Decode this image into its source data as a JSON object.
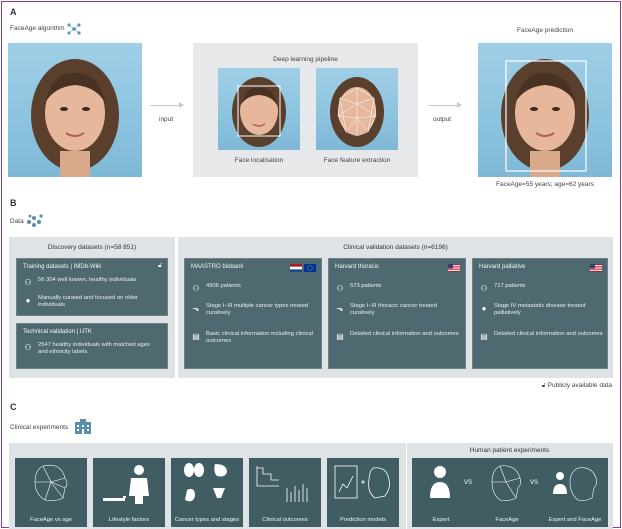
{
  "section_a": {
    "letter": "A",
    "algorithm_label": "FaceAge algorithm",
    "pipeline_title": "Deep learning pipeline",
    "input_label": "input",
    "output_label": "output",
    "step1_caption": "Face localisation",
    "step2_caption": "Face feature extraction",
    "prediction_title": "FaceAge prediction",
    "prediction_result": "FaceAge=55 years; age=62 years"
  },
  "section_b": {
    "letter": "B",
    "data_label": "Data",
    "discovery_title": "Discovery datasets (n=58 851)",
    "clinical_title": "Clinical validation datasets (n=6196)",
    "training": {
      "title": "Training datasets | IMDb-Wiki",
      "line1": "56 304 well known, healthy individuals",
      "line2": "Manually curated and focused on older individuals"
    },
    "technical": {
      "title": "Technical validation | UTK",
      "line1": "2547 healthy individuals with matched ages and ethnicity labels"
    },
    "maastro": {
      "title": "MAASTRO biobank",
      "patients": "4906 patients",
      "line2": "Stage I–III multiple cancer types treated curatively",
      "line3": "Basic clinical information including clinical outcomes"
    },
    "harvard_thoracic": {
      "title": "Harvard thoracic",
      "patients": "573 patients",
      "line2": "Stage I–III thoracic cancer treated curatively",
      "line3": "Detailed clinical information and outcomes"
    },
    "harvard_palliative": {
      "title": "Harvard palliative",
      "patients": "717 patients",
      "line2": "Stage IV metastatic disease treated palliatively",
      "line3": "Detailed clinical information and outcomes"
    },
    "public_note": "Publicly available data"
  },
  "section_c": {
    "letter": "C",
    "experiments_label": "Clinical experiments",
    "human_title": "Human patient experiments",
    "tiles": [
      "FaceAge vs age",
      "Lifestyle factors",
      "Cancer types and stages",
      "Clinical outcomes",
      "Prediction models"
    ],
    "human_tiles": [
      "Expert",
      "FaceAge",
      "Expert and FaceAge"
    ],
    "vs": "VS"
  },
  "colors": {
    "frame": "#8a3d8a",
    "panel_dark": "#3f5d63",
    "card": "#4e6a70",
    "pipeline_bg": "#e6e8ea",
    "photo_bg": "#8cc3df"
  }
}
